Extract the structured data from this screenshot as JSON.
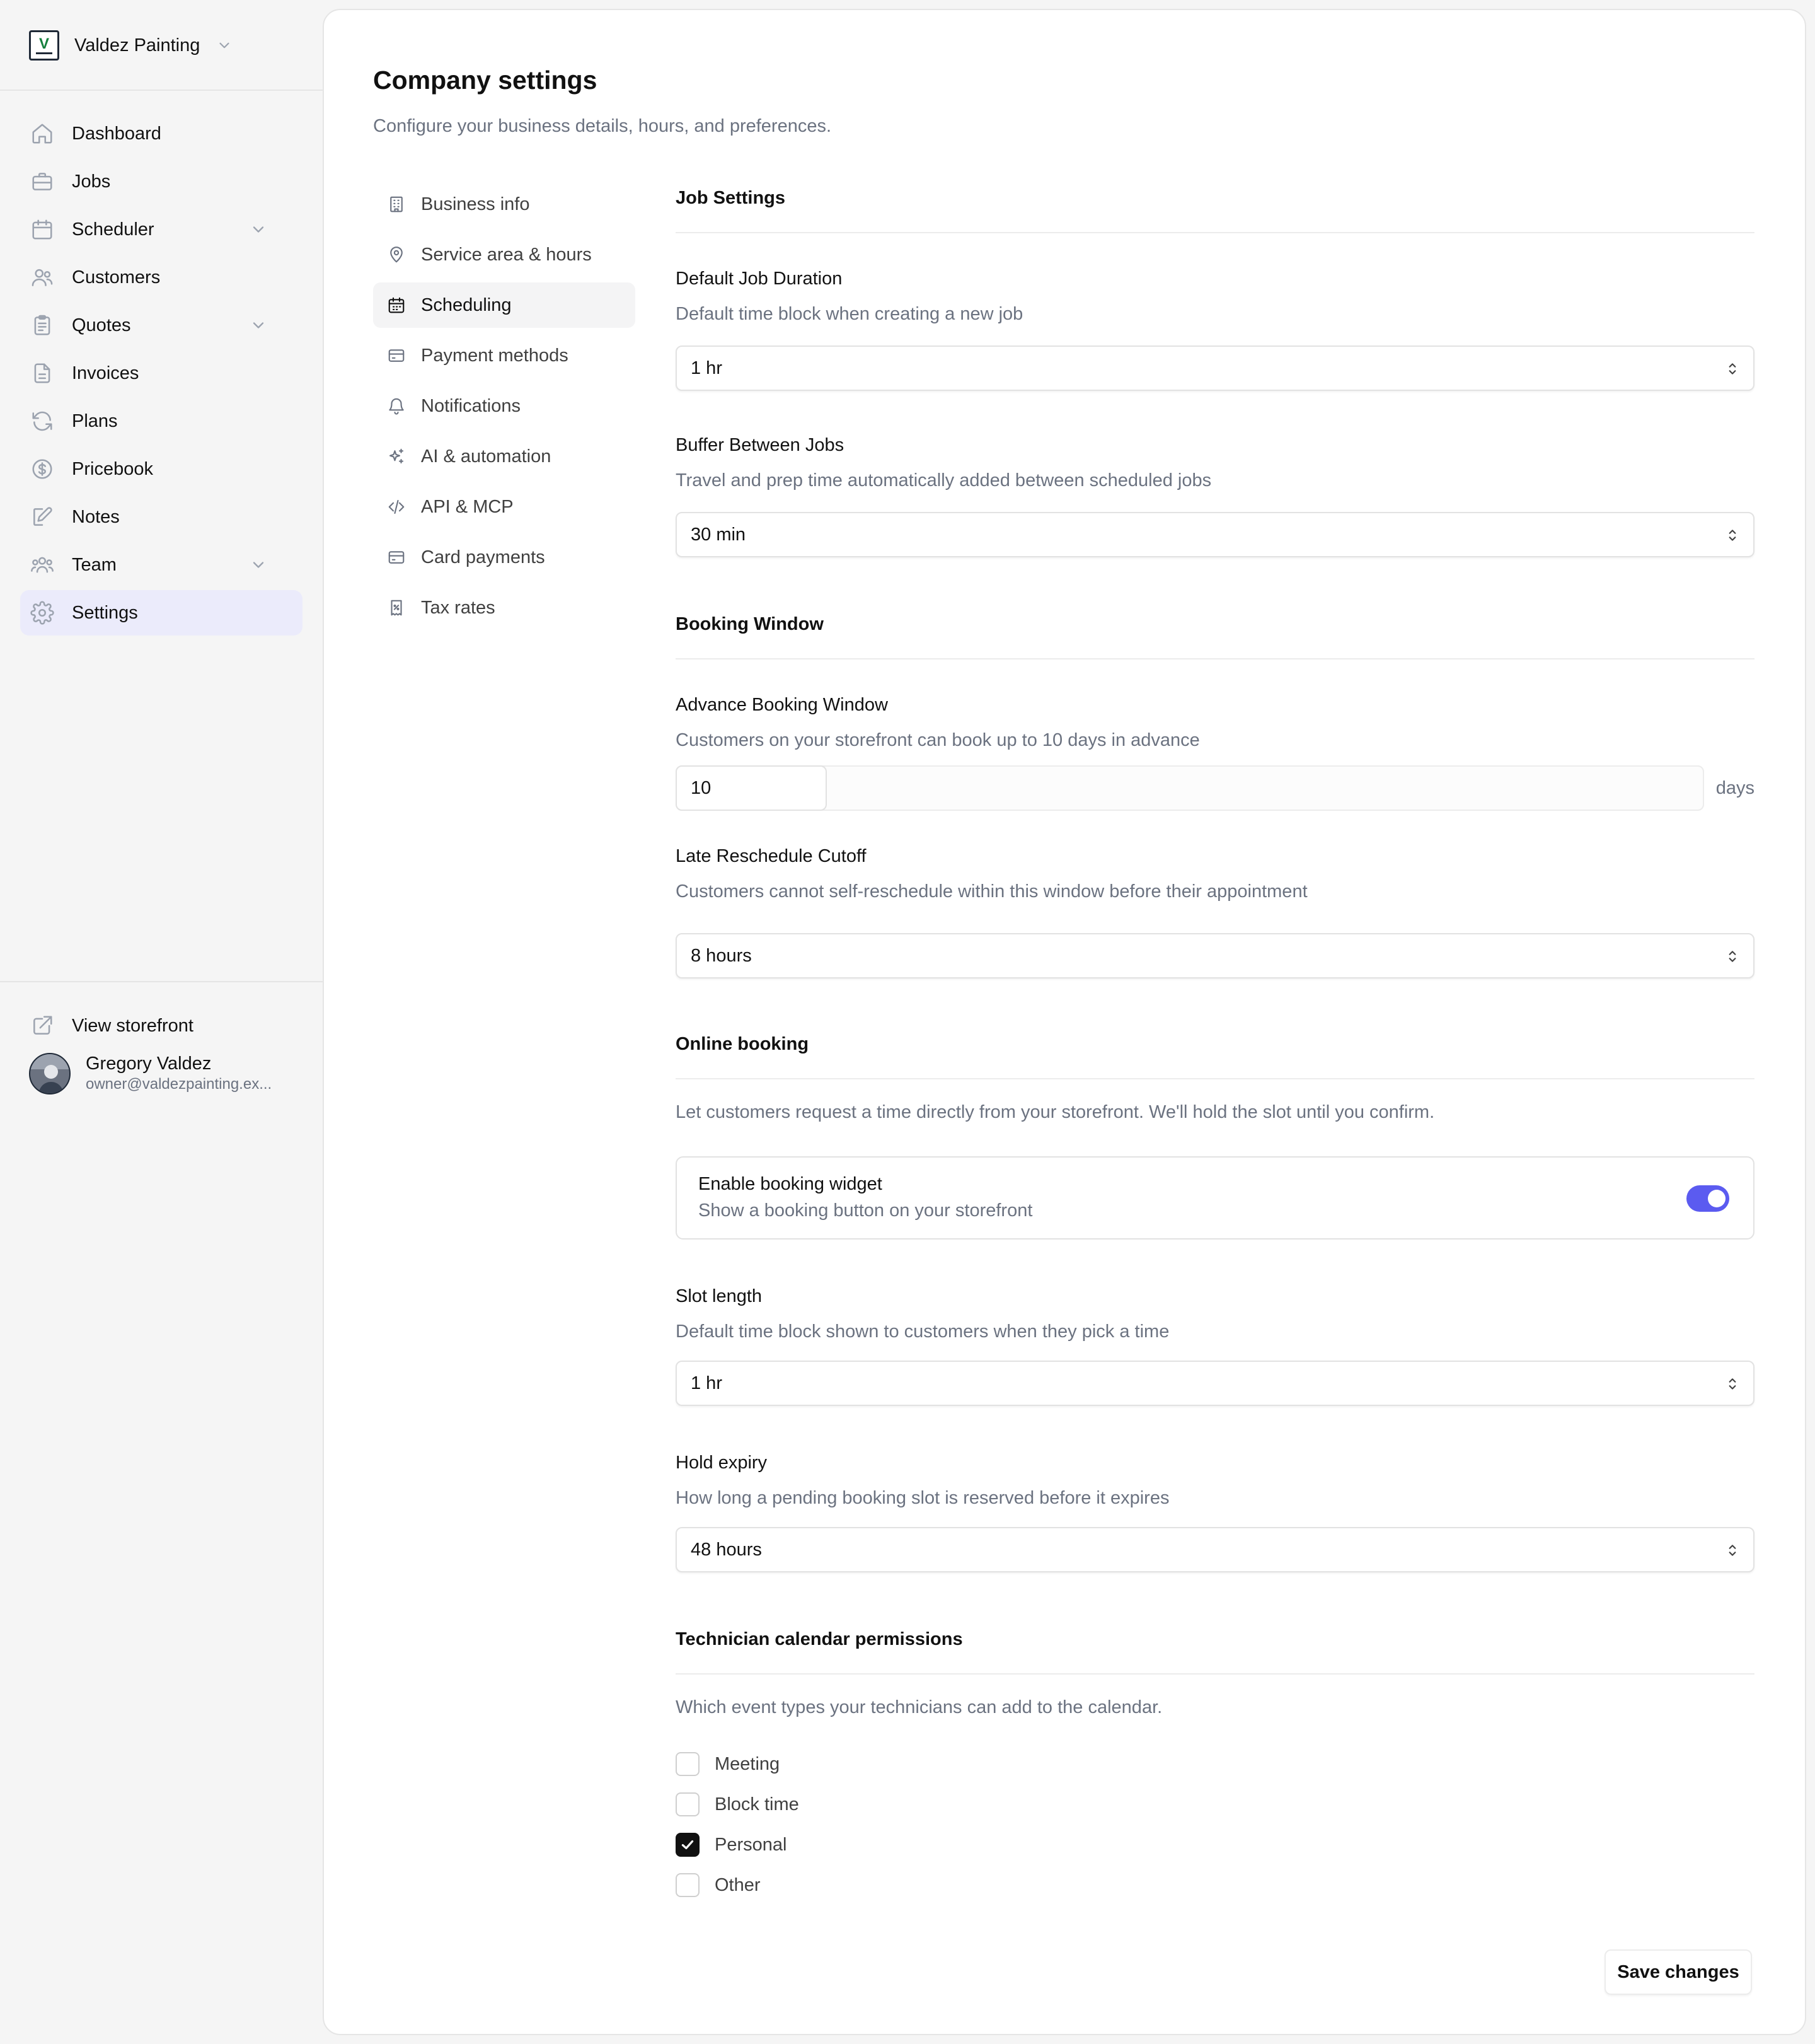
{
  "sidebar": {
    "company": "Valdez Painting",
    "items": [
      {
        "label": "Dashboard",
        "icon": "home-icon"
      },
      {
        "label": "Jobs",
        "icon": "briefcase-icon"
      },
      {
        "label": "Scheduler",
        "icon": "calendar-icon"
      },
      {
        "label": "Customers",
        "icon": "users-icon"
      },
      {
        "label": "Quotes",
        "icon": "clipboard-icon"
      },
      {
        "label": "Invoices",
        "icon": "file-icon"
      },
      {
        "label": "Plans",
        "icon": "refresh-icon"
      },
      {
        "label": "Pricebook",
        "icon": "dollar-icon"
      },
      {
        "label": "Notes",
        "icon": "pencil-icon"
      },
      {
        "label": "Team",
        "icon": "team-icon"
      },
      {
        "label": "Settings",
        "icon": "gear-icon"
      }
    ],
    "active_item": "Settings",
    "view_storefront": "View storefront",
    "user": {
      "name": "Gregory Valdez",
      "email": "owner@valdezpainting.ex..."
    }
  },
  "page": {
    "title": "Company settings",
    "subtitle": "Configure your business details, hours, and preferences."
  },
  "settings_nav": {
    "items": [
      {
        "label": "Business info",
        "icon": "building-icon"
      },
      {
        "label": "Service area & hours",
        "icon": "map-pin-icon"
      },
      {
        "label": "Scheduling",
        "icon": "calendar-icon"
      },
      {
        "label": "Payment methods",
        "icon": "credit-card-icon"
      },
      {
        "label": "Notifications",
        "icon": "bell-icon"
      },
      {
        "label": "AI & automation",
        "icon": "sparkles-icon"
      },
      {
        "label": "API & MCP",
        "icon": "code-icon"
      },
      {
        "label": "Card payments",
        "icon": "credit-card-icon"
      },
      {
        "label": "Tax rates",
        "icon": "receipt-icon"
      }
    ],
    "active_item": "Scheduling"
  },
  "job_settings": {
    "title": "Job Settings",
    "default_duration": {
      "label": "Default Job Duration",
      "help": "Default time block when creating a new job",
      "value": "1 hr"
    },
    "buffer": {
      "label": "Buffer Between Jobs",
      "help": "Travel and prep time automatically added between scheduled jobs",
      "value": "30 min"
    }
  },
  "booking_window": {
    "title": "Booking Window",
    "advance": {
      "label": "Advance Booking Window",
      "help": "Customers on your storefront can book up to 10 days in advance",
      "value": "10",
      "suffix": "days"
    },
    "reschedule": {
      "label": "Late Reschedule Cutoff",
      "help": "Customers cannot self-reschedule within this window before their appointment",
      "value": "8 hours"
    }
  },
  "online_booking": {
    "title": "Online booking",
    "description": "Let customers request a time directly from your storefront. We'll hold the slot until you confirm.",
    "widget": {
      "title": "Enable booking widget",
      "subtitle": "Show a booking button on your storefront",
      "enabled": true
    },
    "slot_length": {
      "label": "Slot length",
      "help": "Default time block shown to customers when they pick a time",
      "value": "1 hr"
    },
    "hold_expiry": {
      "label": "Hold expiry",
      "help": "How long a pending booking slot is reserved before it expires",
      "value": "48 hours"
    }
  },
  "technician_permissions": {
    "title": "Technician calendar permissions",
    "description": "Which event types your technicians can add to the calendar.",
    "options": [
      {
        "label": "Meeting",
        "checked": false
      },
      {
        "label": "Block time",
        "checked": false
      },
      {
        "label": "Personal",
        "checked": true
      },
      {
        "label": "Other",
        "checked": false
      }
    ]
  },
  "actions": {
    "save": "Save changes"
  },
  "colors": {
    "accent": "#5b5bf0",
    "active_nav_bg": "#ebebfb",
    "checkbox_checked": "#111111"
  }
}
